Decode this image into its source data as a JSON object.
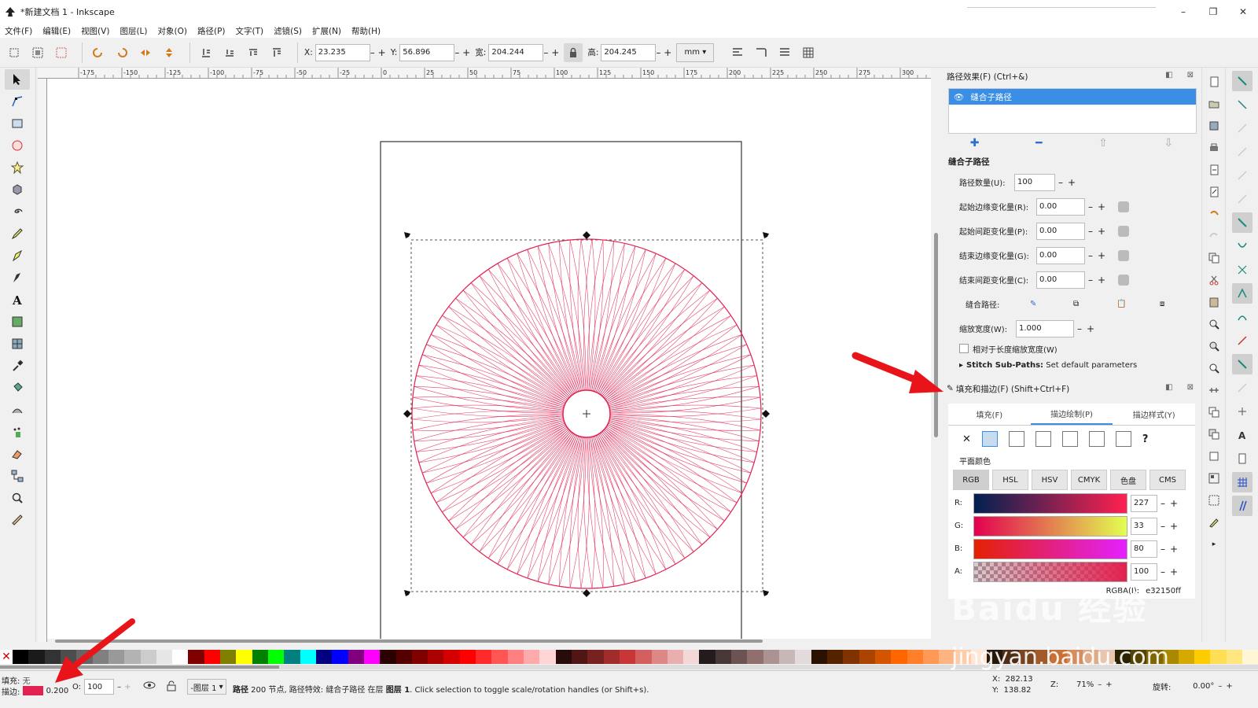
{
  "window": {
    "title": "*新建文档 1 - Inkscape",
    "controls": [
      "–",
      "❐",
      "✕"
    ]
  },
  "menu": [
    "文件(F)",
    "编辑(E)",
    "视图(V)",
    "图层(L)",
    "对象(O)",
    "路径(P)",
    "文字(T)",
    "滤镜(S)",
    "扩展(N)",
    "帮助(H)"
  ],
  "toolbar": {
    "x_label": "X:",
    "x_value": "23.235",
    "y_label": "Y:",
    "y_value": "56.896",
    "w_label": "宽:",
    "w_value": "204.244",
    "h_label": "高:",
    "h_value": "204.245",
    "unit": "mm"
  },
  "ruler_labels": [
    "-175",
    "-150",
    "-125",
    "-100",
    "-75",
    "-50",
    "-25",
    "0",
    "25",
    "50",
    "75",
    "100",
    "125",
    "150",
    "175",
    "200",
    "225",
    "250",
    "275",
    "300"
  ],
  "lpe_panel": {
    "title": "路径效果(F) (Ctrl+&)",
    "effects": [
      "缝合子路径"
    ],
    "section_title": "缝合子路径",
    "params": [
      {
        "label": "路径数量(U):",
        "value": "100"
      },
      {
        "label": "起始边缘变化量(R):",
        "value": "0.00"
      },
      {
        "label": "起始间距变化量(P):",
        "value": "0.00"
      },
      {
        "label": "结束边缘变化量(G):",
        "value": "0.00"
      },
      {
        "label": "结束间距变化量(C):",
        "value": "0.00"
      }
    ],
    "stitch_path_label": "缝合路径:",
    "scale_label": "缩放宽度(W):",
    "scale_value": "1.000",
    "relative_label": "相对于长度缩放宽度(W)",
    "expander_bold": "Stitch Sub-Paths:",
    "expander_text": "Set default parameters"
  },
  "fill_stroke_panel": {
    "title": "填充和描边(F) (Shift+Ctrl+F)",
    "tabs": [
      "填充(F)",
      "描边绘制(P)",
      "描边样式(Y)"
    ],
    "flat_color_label": "平面颜色",
    "models": [
      "RGB",
      "HSL",
      "HSV",
      "CMYK",
      "色盘",
      "CMS"
    ],
    "channels": [
      {
        "label": "R:",
        "value": "227"
      },
      {
        "label": "G:",
        "value": "33"
      },
      {
        "label": "B:",
        "value": "80"
      },
      {
        "label": "A:",
        "value": "100"
      }
    ],
    "rgba_label": "RGBA(I):",
    "rgba_value": "e32150ff"
  },
  "statusbar": {
    "fill_label": "填充:",
    "fill_value": "无",
    "stroke_label": "描边:",
    "stroke_width": "0.200",
    "opacity_label": "O:",
    "opacity_value": "100",
    "layer": "-图层 1",
    "message_bold": "路径",
    "message": " 200 节点, 路径特效: 缝合子路径 在层 ",
    "message_layer": "图层 1",
    "message_tail": ". Click selection to toggle scale/rotation handles (or Shift+s).",
    "x_label": "X:",
    "x_value": "282.13",
    "y_label": "Y:",
    "y_value": "138.82",
    "zoom_label": "Z:",
    "zoom_value": "71%",
    "rotation_label": "旋转:",
    "rotation_value": "0.00°"
  },
  "colors": {
    "accent": "#3b8ee6",
    "stroke": "#e32150",
    "arrow": "#e8141a"
  },
  "watermark": {
    "main": "Baidu 经验",
    "sub": "jingyan.baidu.com"
  }
}
